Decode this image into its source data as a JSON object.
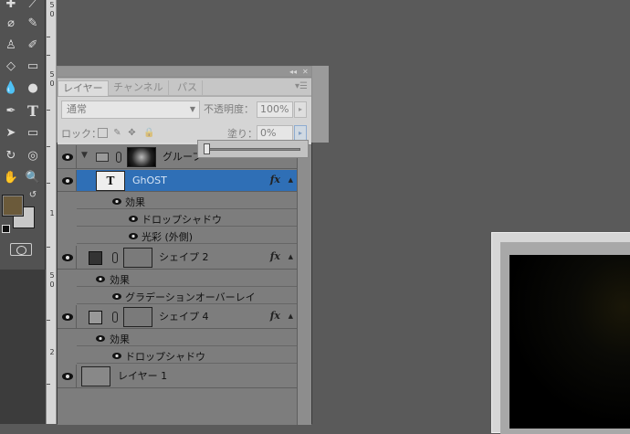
{
  "panel": {
    "tabs": [
      "レイヤー",
      "チャンネル",
      "パス"
    ],
    "active_tab": 0,
    "header_controls": {
      "collapse": "◂◂",
      "close": "✕"
    },
    "menu_icon": "panel-menu-icon"
  },
  "options": {
    "blend_mode": "通常",
    "opacity_label": "不透明度：",
    "opacity_value": "100%",
    "lock_label": "ロック：",
    "fill_label": "塗り：",
    "fill_value": "0%"
  },
  "ruler_marks": [
    "5",
    "0",
    "5",
    "0",
    "1",
    "5",
    "0",
    "2"
  ],
  "layers": [
    {
      "name": "グループ",
      "type": "group",
      "selected": false
    },
    {
      "name": "GhOST",
      "type": "text",
      "selected": true,
      "fx": "fx"
    },
    {
      "effects_label": "効果",
      "items": [
        "ドロップシャドウ",
        "光彩 (外側)"
      ]
    },
    {
      "name": "シェイプ 2",
      "type": "shape",
      "selected": false,
      "fx": "fx"
    },
    {
      "effects_label": "効果",
      "items": [
        "グラデーションオーバーレイ"
      ]
    },
    {
      "name": "シェイプ 4",
      "type": "shape",
      "selected": false,
      "fx": "fx"
    },
    {
      "effects_label": "効果",
      "items": [
        "ドロップシャドウ"
      ]
    },
    {
      "name": "レイヤー 1",
      "type": "pixel",
      "selected": false
    }
  ],
  "colors": {
    "foreground": "#6b5a3a",
    "background": "#c8c8c8",
    "selection": "#2f6fb6"
  }
}
